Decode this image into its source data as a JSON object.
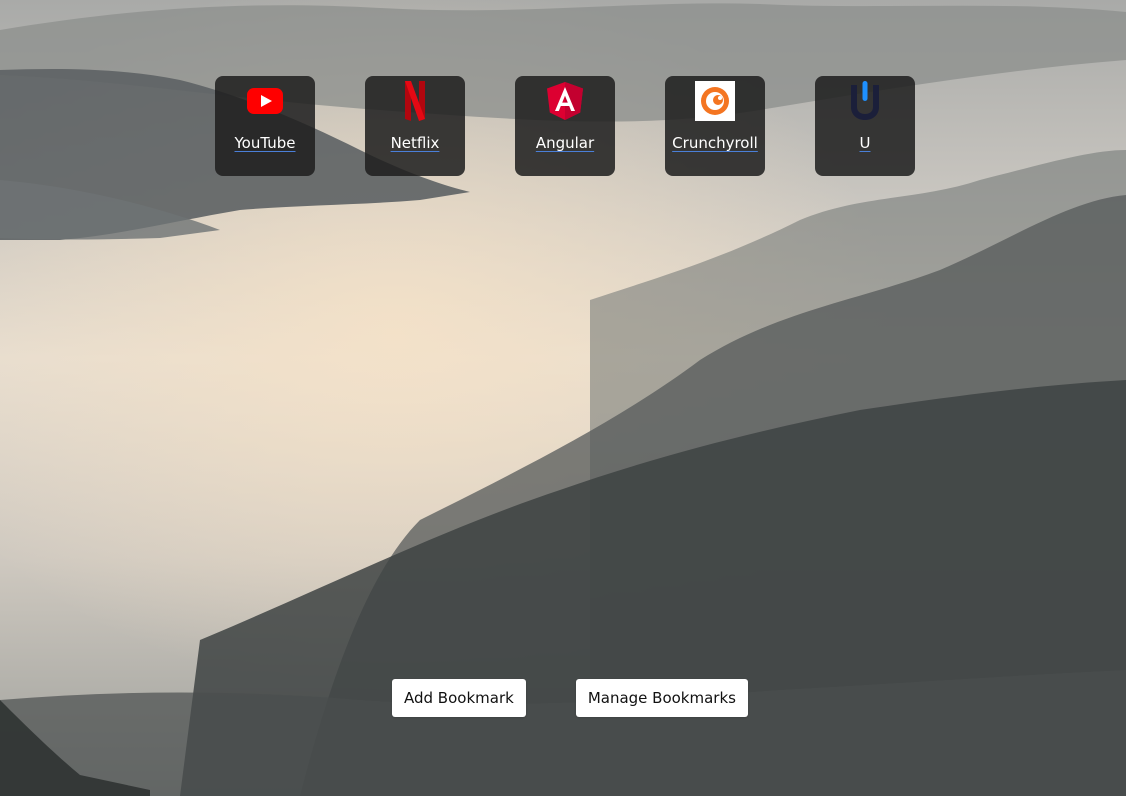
{
  "bookmarks": [
    {
      "label": "YouTube",
      "icon": "youtube-icon",
      "color": "#ff0000"
    },
    {
      "label": "Netflix",
      "icon": "netflix-icon",
      "color": "#e50914"
    },
    {
      "label": "Angular",
      "icon": "angular-icon",
      "color": "#dd0031"
    },
    {
      "label": "Crunchyroll",
      "icon": "crunchyroll-icon",
      "color": "#f47521"
    },
    {
      "label": "U",
      "icon": "u-icon",
      "color": "#1e90ff"
    }
  ],
  "actions": {
    "add_label": "Add Bookmark",
    "manage_label": "Manage Bookmarks"
  }
}
